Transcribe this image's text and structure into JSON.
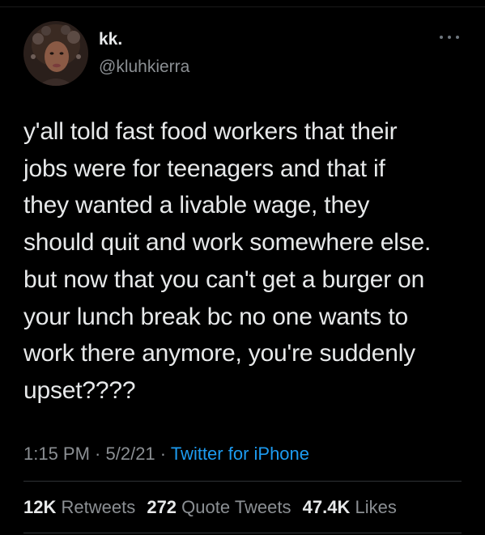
{
  "author": {
    "display_name": "kk.",
    "handle": "@kluhkierra",
    "avatar_icon": "profile-photo"
  },
  "menu": {
    "icon": "more-options-icon"
  },
  "tweet": {
    "text": "y'all told fast food workers that their\njobs were for teenagers and that if\nthey wanted a livable wage, they\nshould quit and work somewhere else.\nbut now that you can't get a burger on\nyour lunch break bc no one wants to\nwork there anymore, you're suddenly\nupset????"
  },
  "meta": {
    "time": "1:15 PM",
    "separator1": " · ",
    "date": "5/2/21",
    "separator2": " · ",
    "source": "Twitter for iPhone"
  },
  "stats": {
    "retweets_count": "12K",
    "retweets_label": "Retweets",
    "quotes_count": "272",
    "quotes_label": "Quote Tweets",
    "likes_count": "47.4K",
    "likes_label": "Likes"
  },
  "colors": {
    "background": "#000000",
    "text": "#e7e9ea",
    "secondary": "#8b8f93",
    "link": "#1d9bf0",
    "divider": "#2f3336"
  }
}
